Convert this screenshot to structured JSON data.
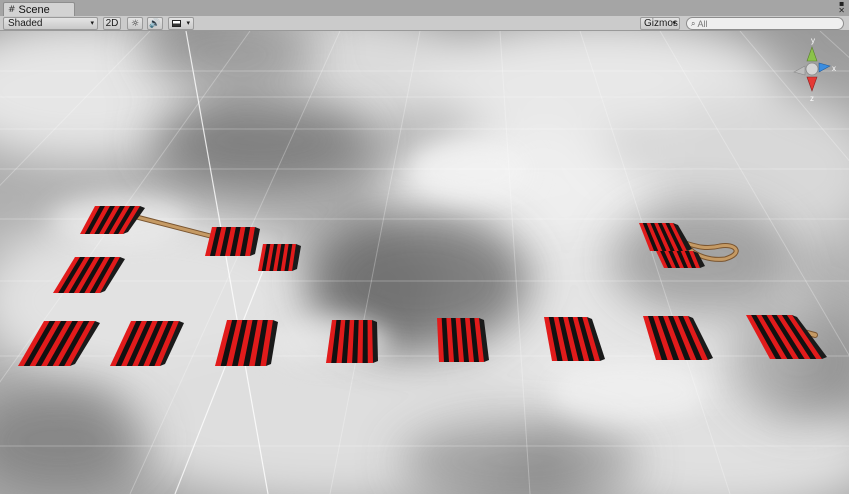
{
  "tab": {
    "label": "Scene",
    "icon": "grid-icon"
  },
  "window_controls": {
    "menu_glyph": "▪",
    "close_glyph": "✕"
  },
  "toolbar": {
    "draw_mode": "Shaded",
    "mode_2d": "2D",
    "lighting_glyph": "☼",
    "audio_glyph": "🔊",
    "gizmos": "Gizmos",
    "search_placeholder": "All"
  },
  "gizmo": {
    "axis_x": "x",
    "axis_y": "y",
    "axis_z": "z"
  },
  "colors": {
    "stripe_red": "#e11b1b",
    "stripe_black": "#111111",
    "rope": "#b98a52"
  }
}
